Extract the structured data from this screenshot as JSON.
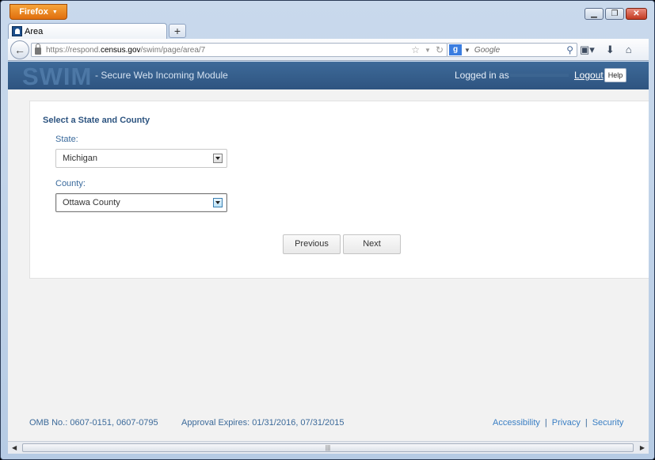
{
  "browser": {
    "menu_label": "Firefox",
    "tab_title": "Area",
    "new_tab_label": "+",
    "url_prefix": "https://respond.",
    "url_domain": "census.gov",
    "url_path": "/swim/page/area/7",
    "search_placeholder": "Google",
    "window_controls": {
      "minimize": "▭",
      "restore": "□",
      "close": "✕"
    }
  },
  "banner": {
    "logo": "SWIM",
    "subtitle": "- Secure Web Incoming Module",
    "logged_in_label": "Logged in as",
    "logout_label": "Logout",
    "help_label": "Help"
  },
  "form": {
    "heading": "Select a State and County",
    "state_label": "State:",
    "state_value": "Michigan",
    "county_label": "County:",
    "county_value": "Ottawa County",
    "previous_label": "Previous",
    "next_label": "Next"
  },
  "footer": {
    "omb": "OMB No.: 0607-0151, 0607-0795",
    "approval": "Approval Expires: 01/31/2016, 07/31/2015",
    "links": [
      "Accessibility",
      "Privacy",
      "Security"
    ],
    "separator": "|"
  },
  "icons": {
    "back": "back-arrow-icon",
    "lock": "lock-icon",
    "bookmark_star": "star-icon",
    "reload": "reload-icon",
    "search": "magnifier-icon",
    "bookmarks": "bookmarks-icon",
    "downloads": "download-icon",
    "home": "home-icon"
  },
  "colors": {
    "banner": "#2e5480",
    "firefox_button": "#e06e0e",
    "link": "#3a7fc4",
    "heading": "#2d5480"
  }
}
